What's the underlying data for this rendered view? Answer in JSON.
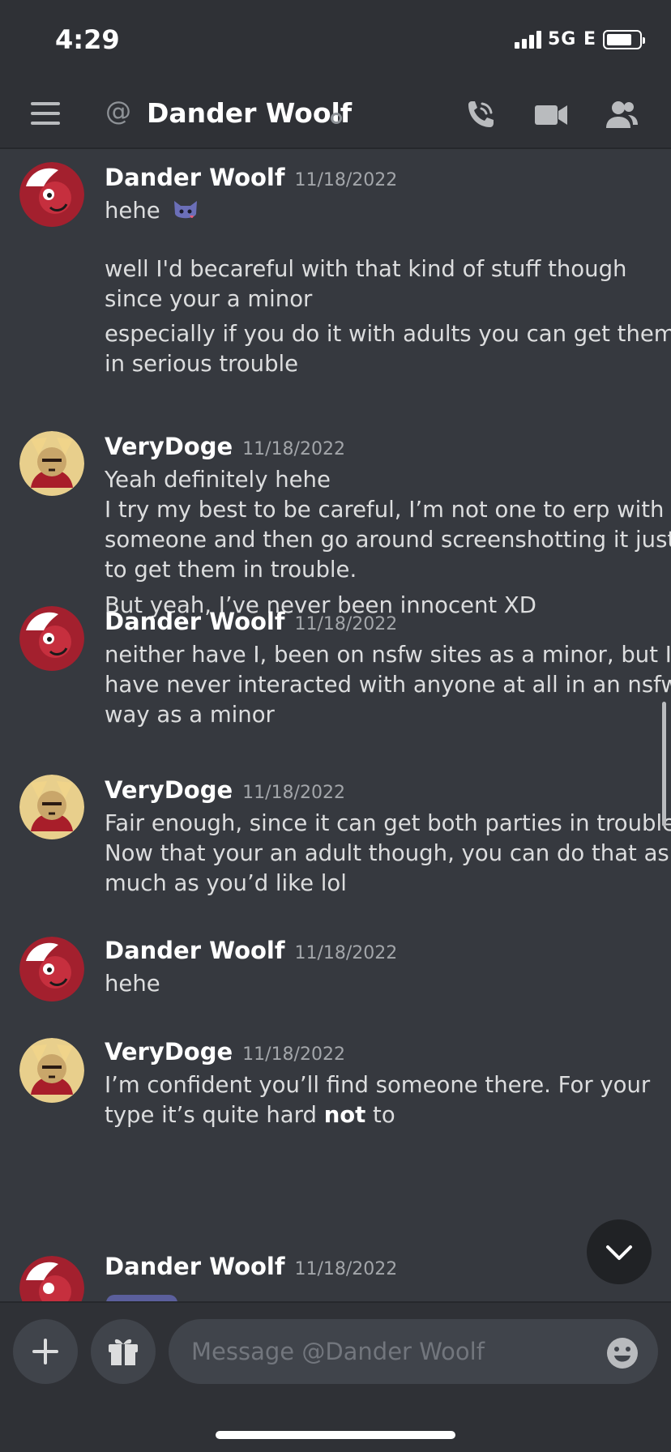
{
  "status_bar": {
    "time": "4:29",
    "network": "5G E"
  },
  "header": {
    "at_symbol": "@",
    "title": "Dander Woolf"
  },
  "colors": {
    "background": "#36393f",
    "header": "#2f3136",
    "author": "#ffffff",
    "text": "#dcddde",
    "timestamp": "#a3a6aa"
  },
  "messages": [
    {
      "author": "Dander Woolf",
      "timestamp": "11/18/2022",
      "lines": [
        "hehe",
        "well I'd becareful with that kind of stuff though",
        "since your a minor",
        "especially if you do it with adults you can get them",
        "in serious trouble"
      ]
    },
    {
      "author": "VeryDoge",
      "timestamp": "11/18/2022",
      "lines": [
        "Yeah definitely hehe",
        "I try my best to be careful, I’m not one to erp with",
        "someone and then go around screenshotting it just",
        "to get them in trouble.",
        "But yeah, I’ve never been innocent XD"
      ]
    },
    {
      "author": "Dander Woolf",
      "timestamp": "11/18/2022",
      "lines": [
        "neither have I, been on nsfw sites as a minor, but I",
        "have never interacted with anyone at all in an nsfw",
        "way as a minor"
      ]
    },
    {
      "author": "VeryDoge",
      "timestamp": "11/18/2022",
      "lines": [
        "Fair enough, since it can get both parties in trouble.",
        "Now that your an adult though, you can do that as",
        "much as you’d like lol"
      ]
    },
    {
      "author": "Dander Woolf",
      "timestamp": "11/18/2022",
      "lines": [
        "hehe"
      ]
    },
    {
      "author": "VeryDoge",
      "timestamp": "11/18/2022",
      "lines": [
        "I’m confident you’ll find someone there. For your",
        "type it’s quite hard ",
        "not",
        " to"
      ]
    },
    {
      "author": "Dander Woolf",
      "timestamp": "11/18/2022",
      "lines": []
    }
  ],
  "composer": {
    "placeholder": "Message @Dander Woolf"
  }
}
